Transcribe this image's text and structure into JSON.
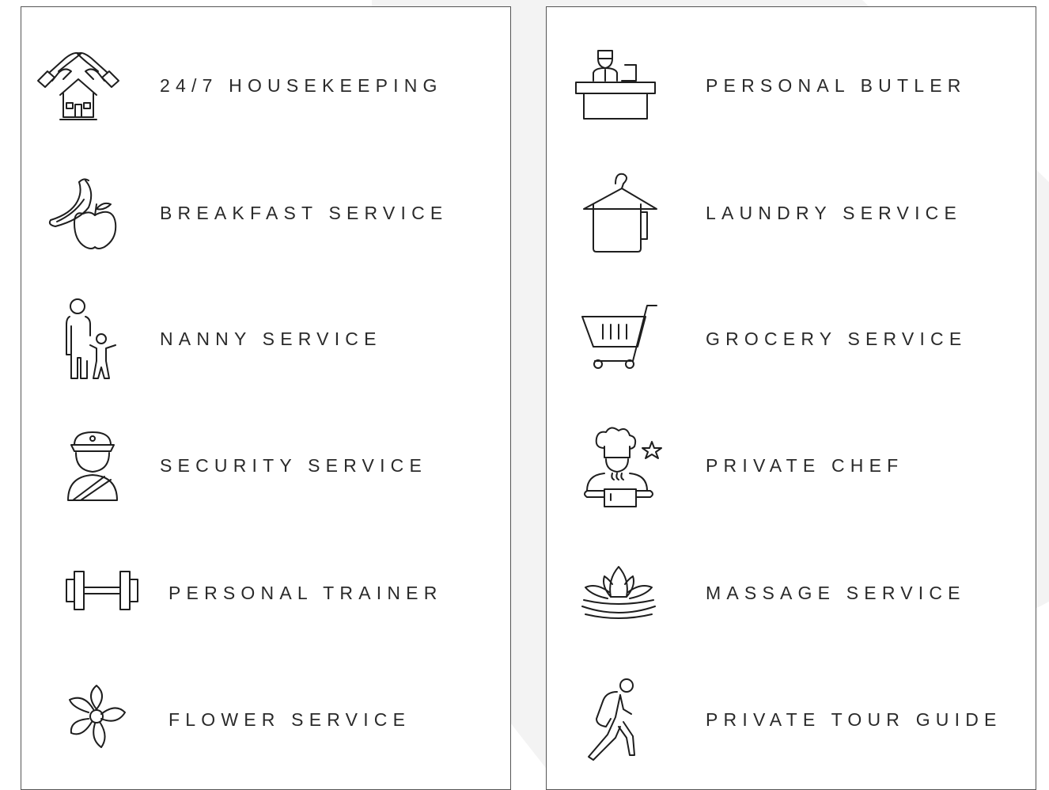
{
  "services_left": [
    {
      "label": "24/7 HOUSEKEEPING",
      "icon": "hands-house-icon"
    },
    {
      "label": "BREAKFAST SERVICE",
      "icon": "banana-apple-icon"
    },
    {
      "label": "NANNY SERVICE",
      "icon": "adult-child-icon"
    },
    {
      "label": "SECURITY SERVICE",
      "icon": "security-guard-icon"
    },
    {
      "label": "PERSONAL TRAINER",
      "icon": "dumbbell-icon"
    },
    {
      "label": "FLOWER SERVICE",
      "icon": "flower-icon"
    }
  ],
  "services_right": [
    {
      "label": "PERSONAL BUTLER",
      "icon": "butler-desk-icon"
    },
    {
      "label": "LAUNDRY SERVICE",
      "icon": "hanger-towel-icon"
    },
    {
      "label": "GROCERY SERVICE",
      "icon": "shopping-cart-icon"
    },
    {
      "label": "PRIVATE CHEF",
      "icon": "chef-icon"
    },
    {
      "label": "MASSAGE SERVICE",
      "icon": "lotus-icon"
    },
    {
      "label": "PRIVATE TOUR GUIDE",
      "icon": "hiker-icon"
    }
  ]
}
